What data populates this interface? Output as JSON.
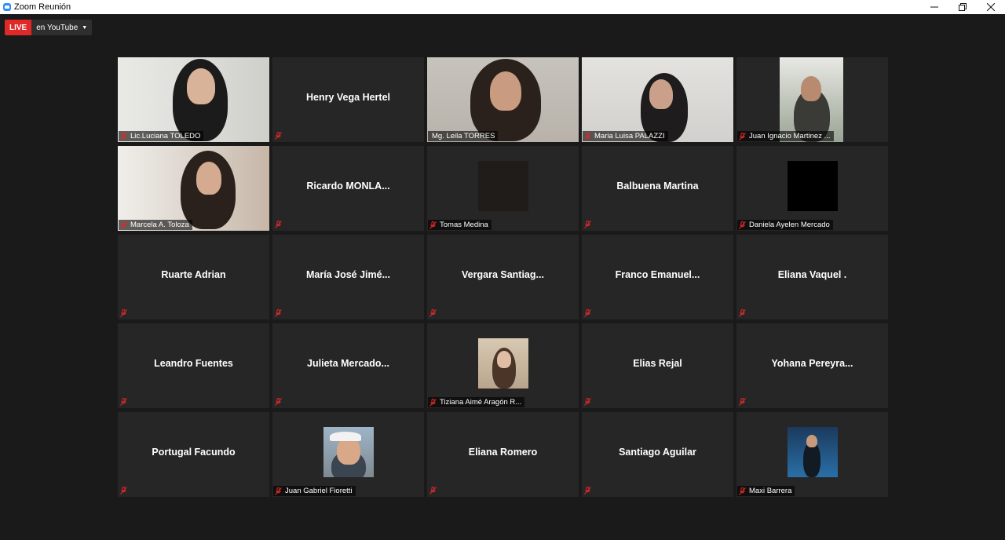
{
  "window": {
    "title": "Zoom Reunión"
  },
  "live": {
    "badge": "LIVE",
    "destination": "en YouTube"
  },
  "participants": [
    {
      "name": "Lic.Luciana TOLEDO"
    },
    {
      "name": "Henry Vega Hertel"
    },
    {
      "name": "Mg. Leila TORRES"
    },
    {
      "name": "Maria Luisa PALAZZI"
    },
    {
      "name": "Juan Ignacio Martinez ..."
    },
    {
      "name": "Marcela A. Toloza"
    },
    {
      "name": "Ricardo  MONLA..."
    },
    {
      "name": "Tomas Medina"
    },
    {
      "name": "Balbuena Martina"
    },
    {
      "name": "Daniela Ayelen Mercado"
    },
    {
      "name": "Ruarte Adrian"
    },
    {
      "name": "María José Jimé..."
    },
    {
      "name": "Vergara Santiag..."
    },
    {
      "name": "Franco  Emanuel..."
    },
    {
      "name": "Eliana Vaquel ."
    },
    {
      "name": "Leandro Fuentes"
    },
    {
      "name": "Julieta  Mercado..."
    },
    {
      "name": "Tiziana Aimé Aragón R..."
    },
    {
      "name": "Elias Rejal"
    },
    {
      "name": "Yohana  Pereyra..."
    },
    {
      "name": "Portugal Facundo"
    },
    {
      "name": "Juan Gabriel Fioretti"
    },
    {
      "name": "Eliana Romero"
    },
    {
      "name": "Santiago Aguilar"
    },
    {
      "name": "Maxi Barrera"
    }
  ],
  "colors": {
    "active_speaker": "#b5e24b",
    "muted_mic": "#e02828",
    "live_badge": "#e02828"
  }
}
